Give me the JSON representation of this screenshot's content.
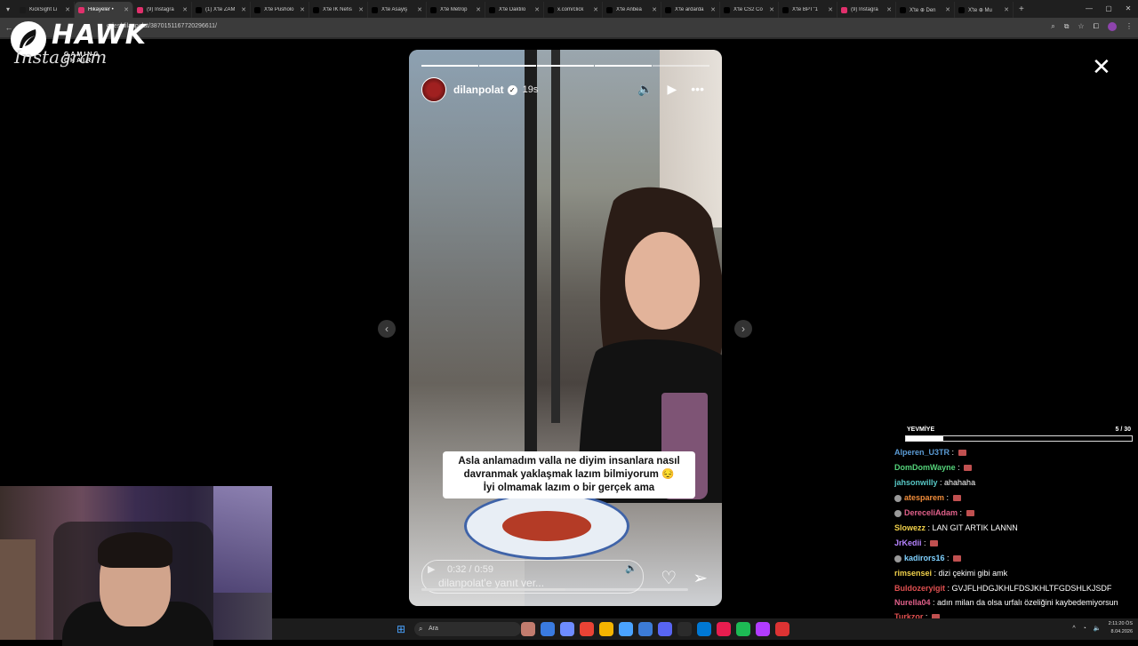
{
  "browser": {
    "tabs": [
      {
        "label": "KickSight Li",
        "color": "#1a1a1a",
        "active": false
      },
      {
        "label": "Hikayeler •",
        "color": "#e1306c",
        "active": true
      },
      {
        "label": "(9) Instagra",
        "color": "#e1306c",
        "active": false
      },
      {
        "label": "(1) X'te ZAM",
        "color": "#000000",
        "active": false
      },
      {
        "label": "X'te Pusholo",
        "color": "#000000",
        "active": false
      },
      {
        "label": "X'te İK Nefis",
        "color": "#000000",
        "active": false
      },
      {
        "label": "X'te Asayiş",
        "color": "#000000",
        "active": false
      },
      {
        "label": "X'te Metrop",
        "color": "#000000",
        "active": false
      },
      {
        "label": "X'te Daktilo",
        "color": "#000000",
        "active": false
      },
      {
        "label": "x.com/click",
        "color": "#000000",
        "active": false
      },
      {
        "label": "X'te Anbea",
        "color": "#000000",
        "active": false
      },
      {
        "label": "X'te ardarda",
        "color": "#000000",
        "active": false
      },
      {
        "label": "X'te CS2 Co",
        "color": "#000000",
        "active": false
      },
      {
        "label": "X'te BPT\"1",
        "color": "#000000",
        "active": false
      },
      {
        "label": "(9) Instagra",
        "color": "#e1306c",
        "active": false
      },
      {
        "label": "X'te ⊕ Den",
        "color": "#000000",
        "active": false
      },
      {
        "label": "X'te ⊕ Mu",
        "color": "#000000",
        "active": false
      }
    ],
    "url": "ories/dilanpolat/3870151167720296611/"
  },
  "overlay": {
    "brand": "HAWK",
    "brand_sub": "GAMING CHAIR",
    "wordmark": "Instagram"
  },
  "story": {
    "username": "dilanpolat",
    "time_ago": "19s",
    "segments_total": 5,
    "segments_done": 4,
    "caption_lines": [
      "Asla anlamadım valla ne diyim insanlara nasıl",
      "davranmak yaklaşmak lazım bilmiyorum 😔",
      "İyi olmamak lazım o bir gerçek ama"
    ],
    "video_time": "0:32 / 0:59",
    "video_progress": 0.54,
    "reply_placeholder": "dilanpolat'e yanıt ver..."
  },
  "chat": {
    "poll_label": "YEVMİYE",
    "poll_count": "5 / 30",
    "poll_fraction": 0.1667,
    "messages": [
      {
        "user": "Alperen_U3TR",
        "color": "#5b9bd5",
        "text": "",
        "emote": true,
        "badge": false
      },
      {
        "user": "DomDomWayne",
        "color": "#54d37a",
        "text": "",
        "emote": true,
        "badge": false
      },
      {
        "user": "jahsonwilly",
        "color": "#57c7c5",
        "text": "ahahaha",
        "emote": false,
        "badge": false
      },
      {
        "user": "atesparem",
        "color": "#f08c3a",
        "text": "",
        "emote": true,
        "badge": true
      },
      {
        "user": "DereceliAdam",
        "color": "#e0608a",
        "text": "",
        "emote": true,
        "badge": true
      },
      {
        "user": "Slowezz",
        "color": "#f2d24b",
        "text": "LAN GIT ARTIK LANNN",
        "emote": false,
        "badge": false
      },
      {
        "user": "JrKedii",
        "color": "#b684ff",
        "text": "",
        "emote": true,
        "badge": false
      },
      {
        "user": "kadirors16",
        "color": "#7fd1ff",
        "text": "",
        "emote": true,
        "badge": true
      },
      {
        "user": "rimsensei",
        "color": "#f2d24b",
        "text": "dizi çekimi gibi amk",
        "emote": false,
        "badge": false
      },
      {
        "user": "Buldozeryigit",
        "color": "#e05050",
        "text": "GVJFLHDGJKHLFDSJKHLTFGDSHLKJSDF",
        "emote": false,
        "badge": false
      },
      {
        "user": "Nurella04",
        "color": "#e0608a",
        "text": "adın milan da olsa urfalı özeliğini kaybedemiyorsun",
        "emote": false,
        "badge": false,
        "wrap": true
      },
      {
        "user": "Turkzor",
        "color": "#e05050",
        "text": "",
        "emote": true,
        "badge": false
      }
    ]
  },
  "taskbar": {
    "search_placeholder": "Ara",
    "time": "2:11:20 ÖS",
    "date": "8.04.2026",
    "apps": [
      "#c27c6e",
      "#3a7be0",
      "#6e8cff",
      "#ea4335",
      "#f5b400",
      "#4aa3ff",
      "#3c7bd6",
      "#5865f2",
      "#2b2b2b",
      "#0078d4",
      "#e81d4f",
      "#1db954",
      "#b23cff",
      "#dd3333"
    ]
  },
  "colors": {
    "accent_pink": "#e1306c"
  }
}
